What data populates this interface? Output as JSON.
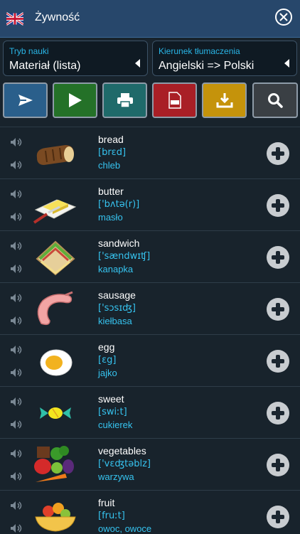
{
  "header": {
    "title": "Żywność",
    "flag_icon": "uk-flag-icon",
    "close_icon": "close-circle-icon"
  },
  "selectors": {
    "mode": {
      "label": "Tryb nauki",
      "value": "Materiał (lista)"
    },
    "direction": {
      "label": "Kierunek tłumaczenia",
      "value": "Angielski => Polski"
    }
  },
  "toolbar": [
    {
      "name": "send",
      "icon": "send-icon",
      "color": "#2a5f8b"
    },
    {
      "name": "play",
      "icon": "play-icon",
      "color": "#247128"
    },
    {
      "name": "print",
      "icon": "printer-icon",
      "color": "#1f6a6a"
    },
    {
      "name": "pdf",
      "icon": "pdf-icon",
      "color": "#a91f26"
    },
    {
      "name": "download",
      "icon": "download-icon",
      "color": "#c5930b"
    },
    {
      "name": "search",
      "icon": "search-icon",
      "color": "#3a3f44"
    }
  ],
  "words": [
    {
      "word": "bread",
      "ipa": "[brɛd]",
      "translation": "chleb",
      "image": "bread-icon"
    },
    {
      "word": "butter",
      "ipa": "['bʌtə(r)]",
      "translation": "masło",
      "image": "butter-icon"
    },
    {
      "word": "sandwich",
      "ipa": "['sændwɪʧ]",
      "translation": "kanapka",
      "image": "sandwich-icon"
    },
    {
      "word": "sausage",
      "ipa": "['sɔsɪʤ]",
      "translation": "kiełbasa",
      "image": "sausage-icon"
    },
    {
      "word": "egg",
      "ipa": "[ɛg]",
      "translation": "jajko",
      "image": "egg-icon"
    },
    {
      "word": "sweet",
      "ipa": "[swiːt]",
      "translation": "cukierek",
      "image": "candy-icon"
    },
    {
      "word": "vegetables",
      "ipa": "['vɛʤtəblz]",
      "translation": "warzywa",
      "image": "vegetables-icon"
    },
    {
      "word": "fruit",
      "ipa": "[fruːt]",
      "translation": "owoc, owoce",
      "image": "fruit-bowl-icon"
    }
  ]
}
